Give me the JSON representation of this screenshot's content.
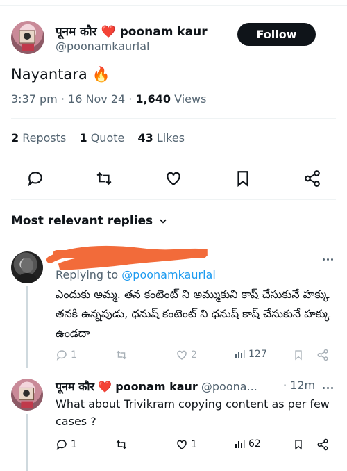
{
  "tweet": {
    "author_name": "पूनम कौर",
    "author_heart": "❤️",
    "author_display": "poonam kaur",
    "author_handle": "@poonamkaurlal",
    "follow_label": "Follow",
    "text": "Nayantara",
    "emoji": "🔥",
    "time": "3:37 pm",
    "date": "16 Nov 24",
    "views_count": "1,640",
    "views_label": "Views",
    "reposts_count": "2",
    "reposts_label": "Reposts",
    "quotes_count": "1",
    "quotes_label": "Quote",
    "likes_count": "43",
    "likes_label": "Likes"
  },
  "actions": [
    "reply-icon",
    "repost-icon",
    "like-icon",
    "bookmark-icon",
    "share-icon"
  ],
  "replies_header": "Most relevant replies",
  "replies": [
    {
      "replying_prefix": "Replying to",
      "replying_handle": "@poonamkaurlal",
      "text": "ఎందుకు అమ్మ. తన కంటెంట్ ని అమ్ముకుని కాష్ చేసుకునే హక్కు తనకి ఉన్నపుడు, ధనుష్ కంటెంట్ ని ధనుష్ కాష్ చేసుకునే హక్కు ఉండదా",
      "reply_count": "1",
      "like_count": "2",
      "view_count": "127"
    },
    {
      "author_name": "पूनम कौर",
      "author_heart": "❤️",
      "author_display": "poonam kaur",
      "author_handle": "@poona...",
      "time": "· 12m",
      "text": "What about Trivikram copying content as per few cases ?",
      "reply_count": "1",
      "like_count": "1",
      "view_count": "62"
    }
  ],
  "colors": {
    "accent": "#1d9bf0",
    "muted": "#536471",
    "heart": "#e0245e",
    "redaction": "#f26b3a"
  }
}
